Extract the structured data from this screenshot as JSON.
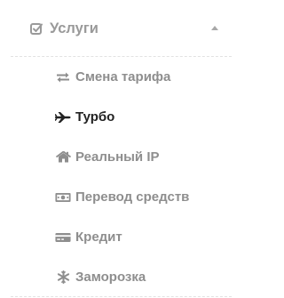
{
  "section": {
    "title": "Услуги",
    "icon": "check-square-icon",
    "expanded": true
  },
  "menu": {
    "items": [
      {
        "label": "Смена тарифа",
        "icon": "exchange-icon",
        "active": false
      },
      {
        "label": "Турбо",
        "icon": "plane-icon",
        "active": true
      },
      {
        "label": "Реальный IP",
        "icon": "home-icon",
        "active": false
      },
      {
        "label": "Перевод средств",
        "icon": "money-icon",
        "active": false
      },
      {
        "label": "Кредит",
        "icon": "credit-card-icon",
        "active": false
      },
      {
        "label": "Заморозка",
        "icon": "snowflake-icon",
        "active": false
      }
    ]
  },
  "colors": {
    "inactive_text": "#8e8e8e",
    "active_text": "#222222",
    "header_text": "#9a9a9a"
  }
}
